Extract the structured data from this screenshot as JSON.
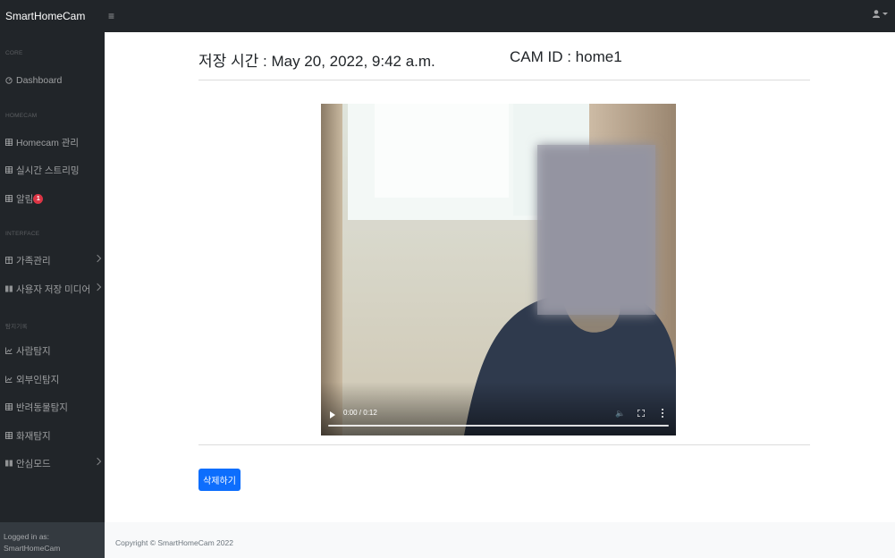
{
  "navbar": {
    "brand": "SmartHomeCam",
    "toggle_icon": "hamburger-icon",
    "user_icon": "user-icon"
  },
  "sidebar": {
    "headings": {
      "core": "CORE",
      "homecam": "HOMECAM",
      "interface": "INTERFACE",
      "detection": "탐지기록"
    },
    "items": [
      {
        "label": "Dashboard",
        "icon": "dashboard-icon"
      },
      {
        "label": "Homecam 관리",
        "icon": "table-icon"
      },
      {
        "label": "실시간 스트리밍",
        "icon": "table-icon"
      },
      {
        "label": "알림",
        "icon": "table-icon",
        "badge": "1"
      },
      {
        "label": "가족관리",
        "icon": "table-icon",
        "has_submenu": true
      },
      {
        "label": "사용자 저장 미디어",
        "icon": "columns-icon",
        "has_submenu": true
      },
      {
        "label": "사람탐지",
        "icon": "chart-icon"
      },
      {
        "label": "외부인탐지",
        "icon": "chart-icon"
      },
      {
        "label": "반려동물탐지",
        "icon": "table-icon"
      },
      {
        "label": "화재탐지",
        "icon": "table-icon"
      },
      {
        "label": "안심모드",
        "icon": "columns-icon",
        "has_submenu": true
      }
    ],
    "footer": {
      "logged_in_label": "Logged in as:",
      "username": "SmartHomeCam"
    }
  },
  "main": {
    "saved_time_label": "저장 시간 : May 20, 2022, 9:42 a.m.",
    "cam_id_label": "CAM ID : home1",
    "video": {
      "time": "0:00 / 0:12",
      "progress": 0
    },
    "delete_button": "삭제하기"
  },
  "footer": {
    "copyright": "Copyright © SmartHomeCam 2022"
  },
  "colors": {
    "sidebar_bg": "#212529",
    "primary": "#0d6efd",
    "badge": "#dc3545"
  }
}
